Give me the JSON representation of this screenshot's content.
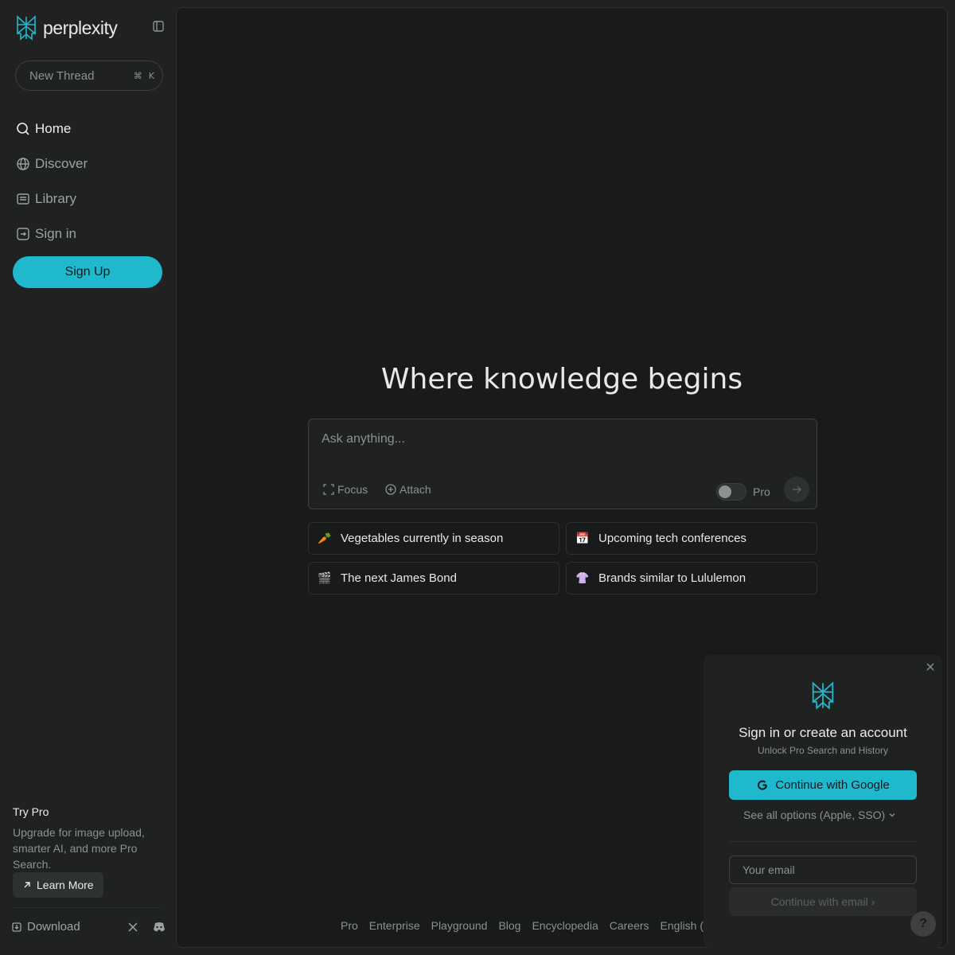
{
  "brand": {
    "name": "perplexity",
    "accent": "#20b8cd"
  },
  "sidebar": {
    "new_thread": {
      "label": "New Thread",
      "shortcut_mod": "⌘",
      "shortcut_key": "K"
    },
    "items": [
      {
        "label": "Home",
        "icon": "search-icon",
        "active": true
      },
      {
        "label": "Discover",
        "icon": "globe-icon",
        "active": false
      },
      {
        "label": "Library",
        "icon": "library-icon",
        "active": false
      },
      {
        "label": "Sign in",
        "icon": "sign-in-icon",
        "active": false
      }
    ],
    "signup_label": "Sign Up",
    "pro_promo": {
      "title": "Try Pro",
      "description": "Upgrade for image upload, smarter AI, and more Pro Search.",
      "button_label": "Learn More"
    },
    "download_label": "Download"
  },
  "main": {
    "headline": "Where knowledge begins",
    "ask": {
      "placeholder": "Ask anything...",
      "focus_label": "Focus",
      "attach_label": "Attach",
      "pro_label": "Pro"
    },
    "suggestions": [
      {
        "emoji": "🥕",
        "label": "Vegetables currently in season"
      },
      {
        "emoji": "📅",
        "label": "Upcoming tech conferences"
      },
      {
        "emoji": "🎬",
        "label": "The next James Bond"
      },
      {
        "emoji": "👚",
        "label": "Brands similar to Lululemon"
      }
    ]
  },
  "auth": {
    "title": "Sign in or create an account",
    "subtitle": "Unlock Pro Search and History",
    "google_label": "Continue with Google",
    "see_all_label": "See all options (Apple, SSO)",
    "email_placeholder": "Your email",
    "email_button_label": "Continue with email ›"
  },
  "footer": {
    "links": [
      "Pro",
      "Enterprise",
      "Playground",
      "Blog",
      "Encyclopedia",
      "Careers"
    ],
    "language": "English (English)"
  },
  "help_label": "?"
}
